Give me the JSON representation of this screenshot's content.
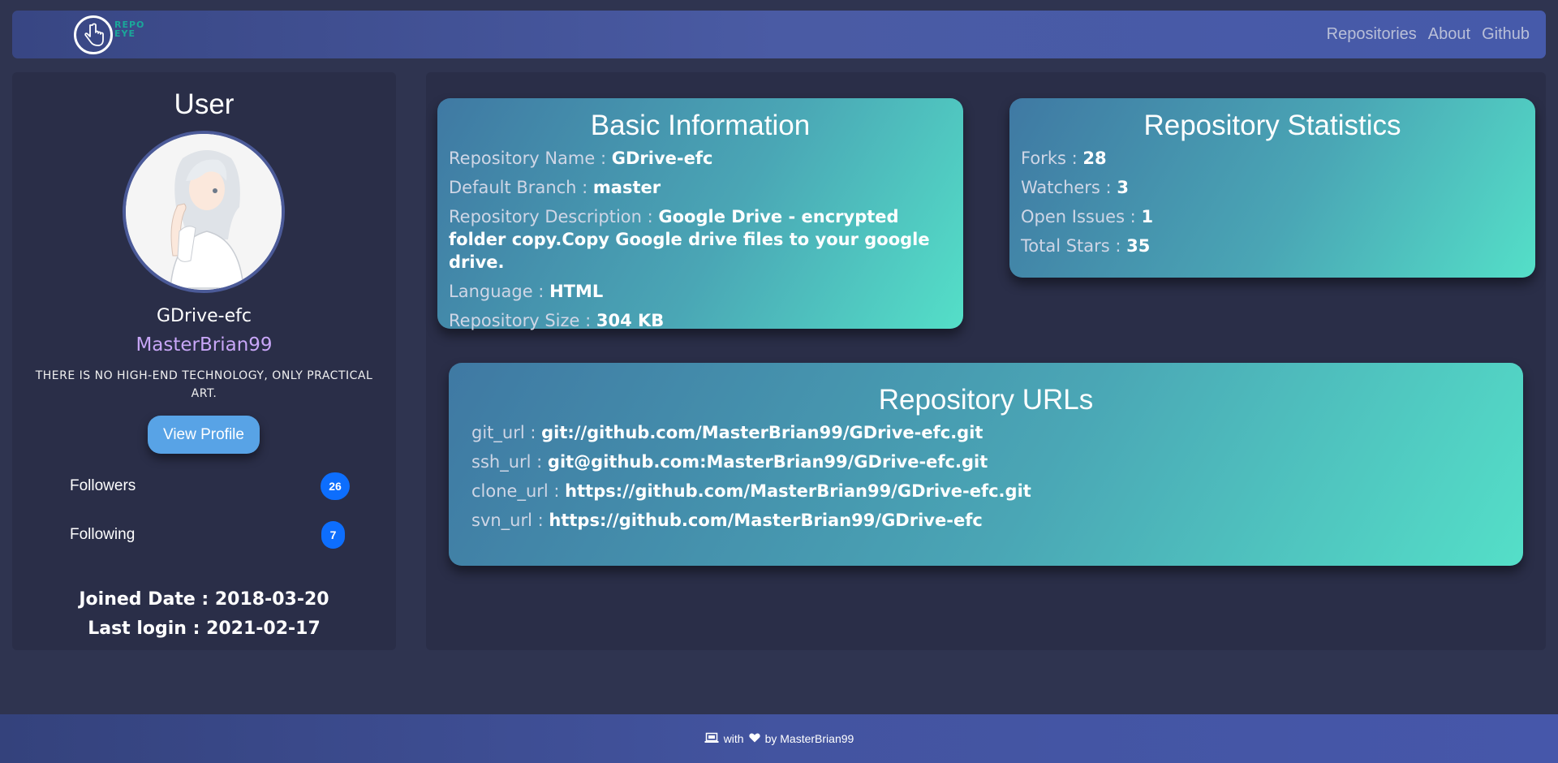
{
  "navbar": {
    "logo_text_line1": "REPO",
    "logo_text_line2": "EYE",
    "links": [
      "Repositories",
      "About",
      "Github"
    ]
  },
  "sidebar": {
    "title": "User",
    "name": "GDrive-efc",
    "login": "MasterBrian99",
    "bio": "THERE IS NO HIGH-END TECHNOLOGY, ONLY PRACTICAL ART.",
    "view_profile_label": "View Profile",
    "followers_label": "Followers",
    "followers_count": "26",
    "following_label": "Following",
    "following_count": "7",
    "joined_label": "Joined Date : ",
    "joined_value": "2018-03-20",
    "last_login_label": "Last login : ",
    "last_login_value": "2021-02-17"
  },
  "basic_info": {
    "title": "Basic Information",
    "fields": [
      {
        "label": "Repository Name : ",
        "value": "GDrive-efc"
      },
      {
        "label": "Default Branch : ",
        "value": "master"
      },
      {
        "label": "Repository Description : ",
        "value": "Google Drive - encrypted folder copy.Copy Google drive files to your google drive."
      },
      {
        "label": "Language : ",
        "value": "HTML"
      },
      {
        "label": "Repository Size : ",
        "value": "304 KB"
      }
    ]
  },
  "repo_stats": {
    "title": "Repository Statistics",
    "fields": [
      {
        "label": "Forks : ",
        "value": "28"
      },
      {
        "label": "Watchers : ",
        "value": "3"
      },
      {
        "label": "Open Issues : ",
        "value": "1"
      },
      {
        "label": "Total Stars : ",
        "value": "35"
      }
    ]
  },
  "repo_urls": {
    "title": "Repository URLs",
    "fields": [
      {
        "label": "git_url : ",
        "value": "git://github.com/MasterBrian99/GDrive-efc.git"
      },
      {
        "label": "ssh_url : ",
        "value": "git@github.com:MasterBrian99/GDrive-efc.git"
      },
      {
        "label": "clone_url : ",
        "value": "https://github.com/MasterBrian99/GDrive-efc.git"
      },
      {
        "label": "svn_url : ",
        "value": "https://github.com/MasterBrian99/GDrive-efc"
      }
    ]
  },
  "footer": {
    "with": "with",
    "by": "by MasterBrian99"
  },
  "colors": {
    "background": "#2f3450",
    "panel": "#2a2e48",
    "login_accent": "#c8a6f7",
    "badge": "#0d6efd",
    "button": "#58a3e6"
  },
  "icons": [
    "pointer-hand-icon",
    "laptop-icon",
    "heart-icon"
  ]
}
